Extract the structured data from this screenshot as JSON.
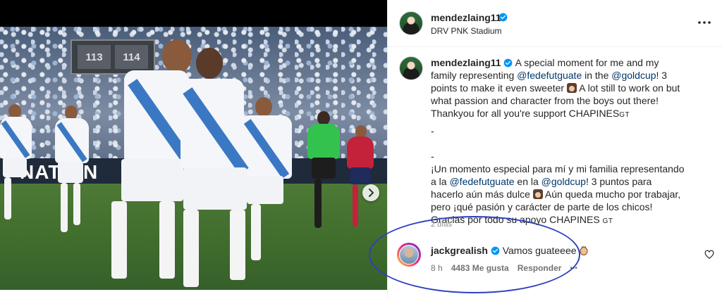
{
  "post": {
    "author": "mendezlaing11",
    "location": "DRV PNK Stadium",
    "caption_author": "mendezlaing11",
    "caption_en_1": "A special moment for me and my family representing",
    "mention_1": "@fedefutguate",
    "caption_en_2": "in the",
    "mention_2": "@goldcup",
    "caption_en_3": "! 3 points to make it even sweeter",
    "caption_en_4": "A lot still to work on but what passion and character from the boys out there! Thankyou for all you're support CHAPINES",
    "gt": "GT",
    "dash_1": "-",
    "dash_2": "-",
    "caption_es_1": "¡Un momento especial para mí y mi familia representando a la",
    "mention_3": "@fedefutguate",
    "caption_es_2": "en la",
    "mention_4": "@goldcup",
    "caption_es_3": "! 3 puntos para hacerlo aún más dulce",
    "caption_es_4": "Aún queda mucho por trabajar, pero ¡qué pasión y carácter de parte de los chicos! Gracias por todo su apoyo CHAPINES",
    "time_ago": "2 días"
  },
  "photo": {
    "score_left": "113",
    "score_right": "114",
    "board_text": "NATION"
  },
  "comment": {
    "author": "jackgrealish",
    "text": "Vamos guateeee",
    "time": "8 h",
    "likes": "4483 Me gusta",
    "reply": "Responder",
    "more": "•••"
  },
  "colors": {
    "verified": "#0095f6",
    "link": "#00376b",
    "highlight_ellipse": "#2e3fc0"
  },
  "icons": [
    "verified-icon",
    "more-options-icon",
    "next-arrow-icon",
    "heart-icon",
    "clap-emoji-icon"
  ]
}
